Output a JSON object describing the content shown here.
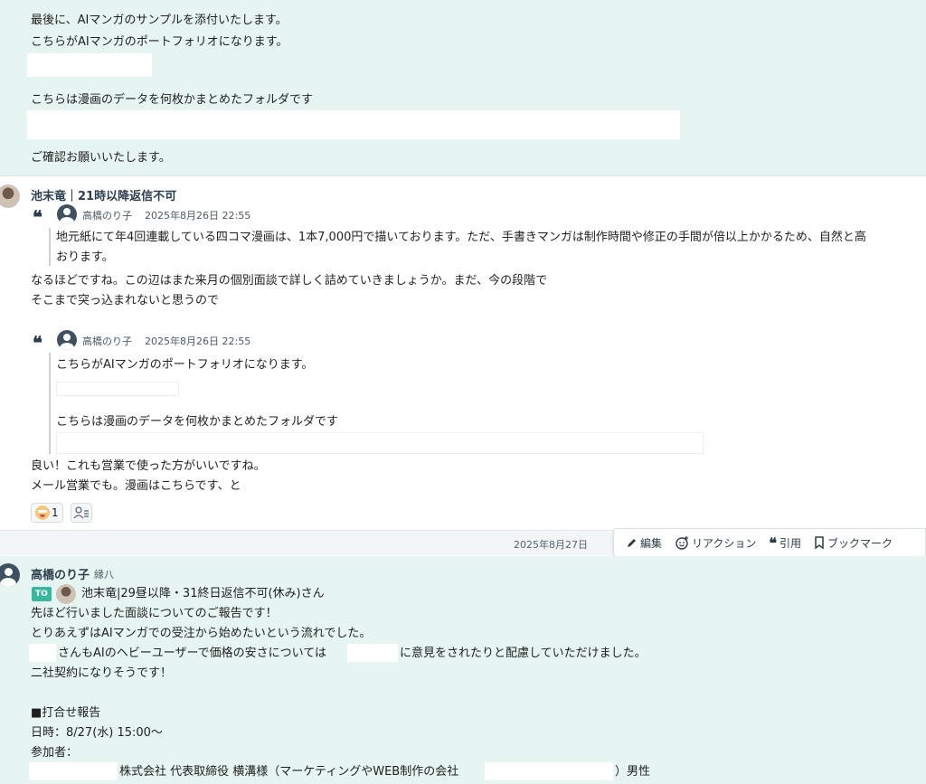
{
  "top_message": {
    "line1": "最後に、AIマンガのサンプルを添付いたします。",
    "line2": "こちらがAIマンガのポートフォリオになります。",
    "line3": "こちらは漫画のデータを何枚かまとめたフォルダです",
    "line4": "ご確認お願いいたします。"
  },
  "mid_message": {
    "sender": "池末竜｜21時以降返信不可",
    "quote1": {
      "author": "高橋のり子",
      "datetime": "2025年8月26日 22:55",
      "line1": "地元紙にて年4回連載している四コマ漫画は、1本7,000円で描いております。ただ、手書きマンガは制作時間や修正の手間が倍以上かかるため、自然と高",
      "line2": "おります。"
    },
    "body1": "なるほどですね。この辺はまた来月の個別面談で詳しく詰めていきましょうか。まだ、今の段階で",
    "body2": "そこまで突っ込まれないと思うので",
    "quote2": {
      "author": "高橋のり子",
      "datetime": "2025年8月26日 22:55",
      "line1": "こちらがAIマンガのポートフォリオになります。",
      "line2": "こちらは漫画のデータを何枚かまとめたフォルダです"
    },
    "body3": "良い！これも営業で使った方がいいですね。",
    "body4": "メール営業でも。漫画はこちらです、と",
    "reaction_count": "1"
  },
  "date_bar": {
    "date": "2025年8月27日"
  },
  "actions": {
    "edit": "編集",
    "reaction": "リアクション",
    "quote": "引用",
    "bookmark": "ブックマーク"
  },
  "bottom_message": {
    "sender": "高橋のり子",
    "sender_sub": "縁八",
    "to_badge": "TO",
    "to_name": "池末竜|29昼以降・31終日返信不可(休み)さん",
    "line1": "先ほど行いました面談についてのご報告です！",
    "line2": "とりあえずはAIマンガでの受注から始めたいという流れでした。",
    "line3a": "さんもAIのヘビーユーザーで価格の安さについては",
    "line3b": "に意見をされたりと配慮していただけました。",
    "line4": "二社契約になりそうです！",
    "line5": "■打合せ報告",
    "line6": "日時：8/27(水) 15:00〜",
    "line7": "参加者：",
    "line8a": "株式会社 代表取締役 横溝様（マーケティングやWEB制作の会社",
    "line8b": "）男性"
  }
}
